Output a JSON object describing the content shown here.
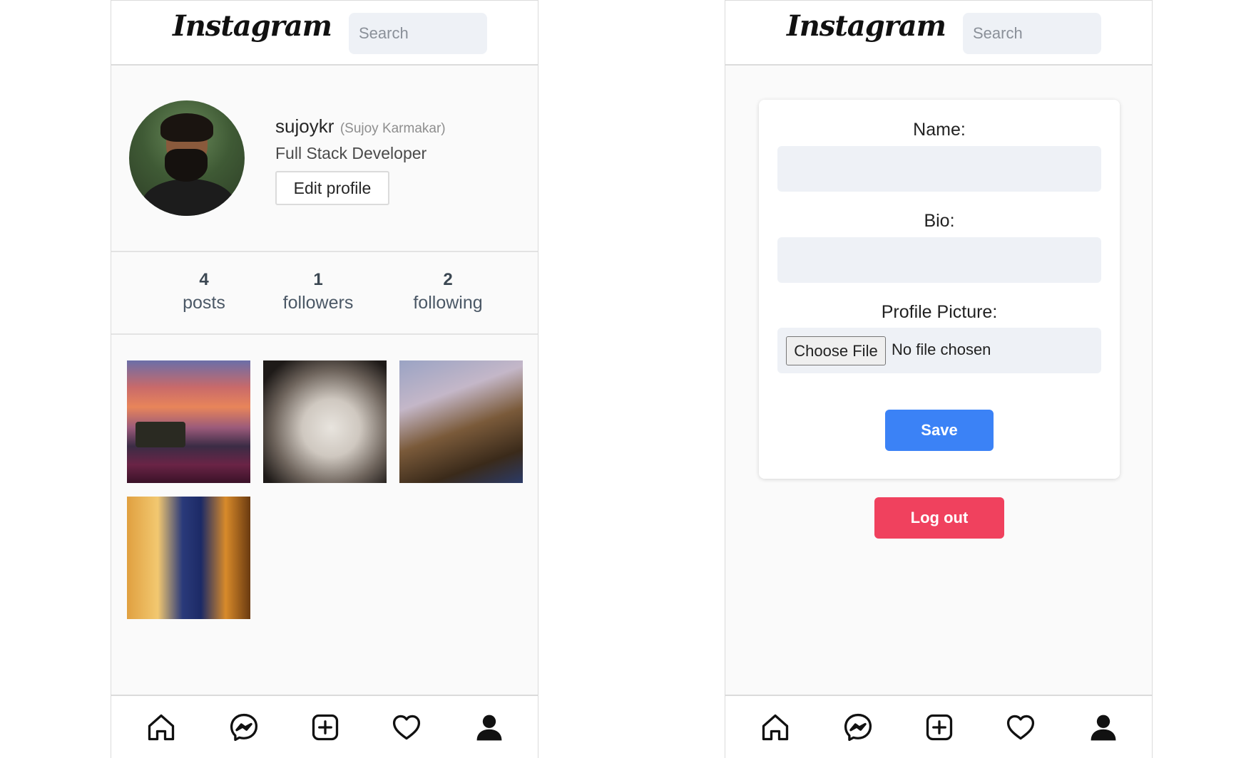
{
  "brand": {
    "logo_text": "Instagram"
  },
  "search": {
    "placeholder": "Search"
  },
  "profile": {
    "username": "sujoykr",
    "full_name": "(Sujoy Karmakar)",
    "bio": "Full Stack Developer",
    "edit_button_label": "Edit profile",
    "stats": [
      {
        "value": "4",
        "label": "posts"
      },
      {
        "value": "1",
        "label": "followers"
      },
      {
        "value": "2",
        "label": "following"
      }
    ],
    "posts_count_shown": 4
  },
  "edit_form": {
    "name_label": "Name:",
    "bio_label": "Bio:",
    "picture_label": "Profile Picture:",
    "choose_file_label": "Choose File",
    "file_status": "No file chosen",
    "save_label": "Save",
    "logout_label": "Log out"
  },
  "nav": {
    "items": [
      "home-icon",
      "messenger-icon",
      "add-post-icon",
      "heart-icon",
      "profile-icon"
    ]
  },
  "colors": {
    "save": "#3b82f6",
    "logout": "#f0415e",
    "input_bg": "#eef1f6",
    "page_bg": "#fafafa"
  }
}
